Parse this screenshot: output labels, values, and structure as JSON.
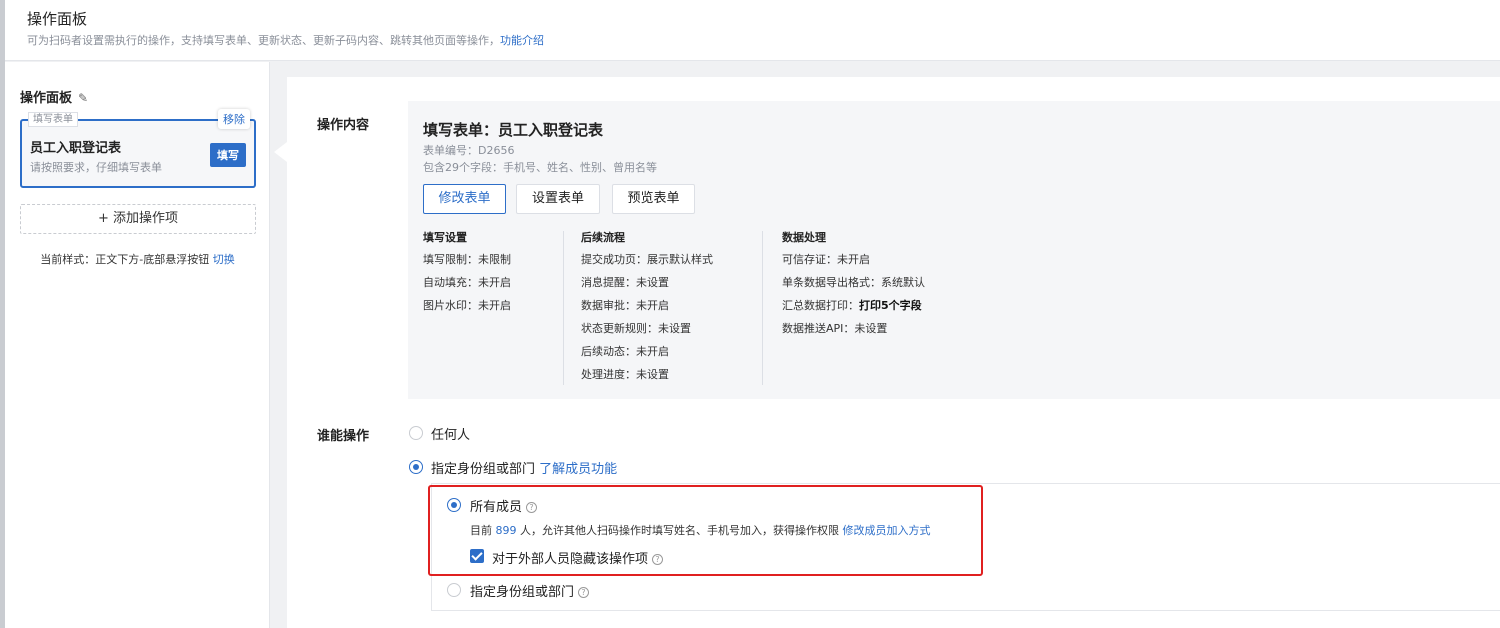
{
  "header": {
    "title": "操作面板",
    "subtitle": "可为扫码者设置需执行的操作，支持填写表单、更新状态、更新子码内容、跳转其他页面等操作，",
    "intro_link": "功能介绍"
  },
  "sidebar": {
    "title": "操作面板",
    "edit_icon": "pencil-icon",
    "card": {
      "tag": "填写表单",
      "remove": "移除",
      "title": "员工入职登记表",
      "desc": "请按照要求，仔细填写表单",
      "button": "填写"
    },
    "add_button": "+ 添加操作项",
    "style_label": "当前样式：正文下方-底部悬浮按钮",
    "switch_link": "切换"
  },
  "main": {
    "content_label": "操作内容",
    "form": {
      "title": "填写表单：员工入职登记表",
      "id": "表单编号：D2656",
      "fields": "包含29个字段：手机号、姓名、性别、曾用名等",
      "buttons": [
        "修改表单",
        "设置表单",
        "预览表单"
      ]
    },
    "columns": [
      {
        "heading": "填写设置",
        "items": [
          "填写限制：未限制",
          "自动填充：未开启",
          "图片水印：未开启"
        ]
      },
      {
        "heading": "后续流程",
        "items": [
          "提交成功页：展示默认样式",
          "消息提醒：未设置",
          "数据审批：未开启",
          "状态更新规则：未设置",
          "后续动态：未开启",
          "处理进度：未设置"
        ]
      },
      {
        "heading": "数据处理",
        "items": [
          "可信存证：未开启",
          "单条数据导出格式：系统默认",
          "汇总数据打印：",
          "数据推送API：未设置"
        ],
        "bold_suffix": "打印5个字段"
      }
    ],
    "who_label": "谁能操作",
    "options": {
      "anyone": "任何人",
      "specified": "指定身份组或部门",
      "learn_link": "了解成员功能",
      "all_members": "所有成员",
      "member_desc_prefix": "目前",
      "member_count": "899",
      "member_desc_suffix": "人，允许其他人扫码操作时填写姓名、手机号加入，获得操作权限",
      "modify_link": "修改成员加入方式",
      "hide_external": "对于外部人员隐藏该操作项",
      "specified_sub": "指定身份组或部门"
    }
  }
}
